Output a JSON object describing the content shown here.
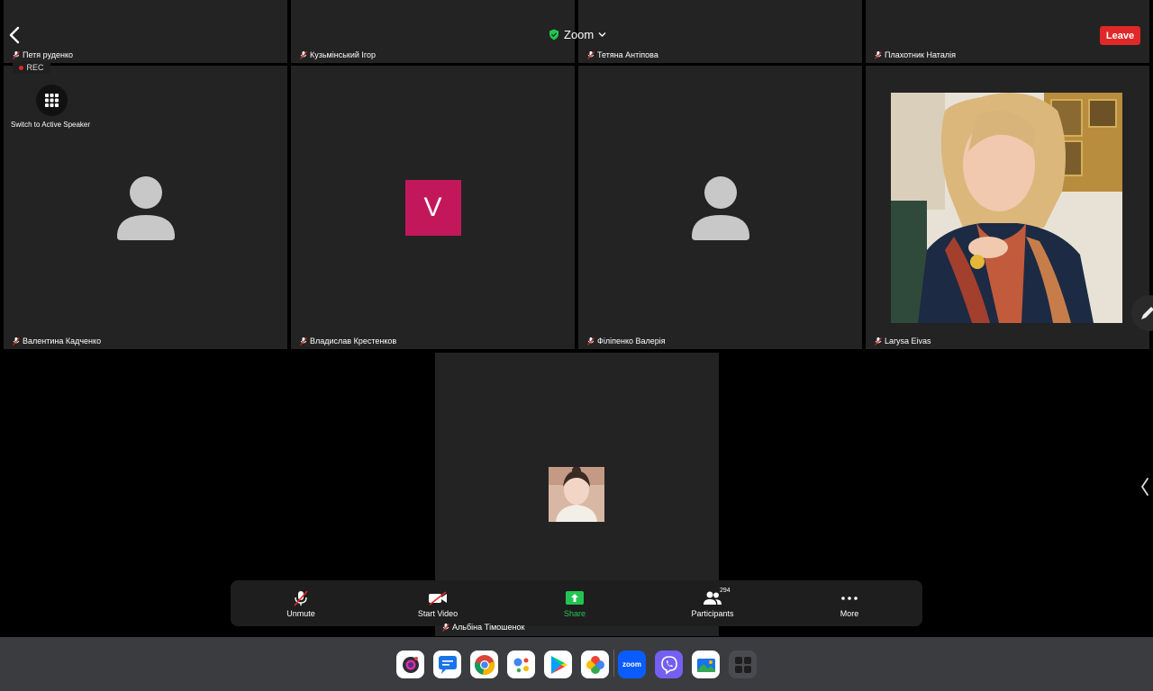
{
  "header": {
    "title": "Zoom",
    "leave_label": "Leave",
    "rec_label": "REC",
    "switch_label": "Switch to Active Speaker"
  },
  "participants_top": [
    {
      "name": "Петя руденко"
    },
    {
      "name": "Кузьмінський Ігор"
    },
    {
      "name": "Тетяна Антіпова"
    },
    {
      "name": "Плахотник Наталія"
    }
  ],
  "participants_main": [
    {
      "name": "Валентина Кадченко",
      "avatar": "person-icon"
    },
    {
      "name": "Владислав Крестенков",
      "avatar_letter": "V",
      "avatar_color": "#c2185b"
    },
    {
      "name": "Філіпенко Валерія",
      "avatar": "person-icon"
    },
    {
      "name": "Larysa Eivas",
      "avatar": "photo"
    }
  ],
  "active": {
    "name": "Альбіна Тімошенок"
  },
  "toolbar": {
    "unmute": "Unmute",
    "start_video": "Start Video",
    "share": "Share",
    "participants": "Participants",
    "participants_count": "294",
    "more": "More"
  },
  "colors": {
    "accent_green": "#23c552",
    "leave_red": "#e02828",
    "rec_red": "#e02828",
    "tile_bg": "#232323"
  },
  "dock_apps": [
    "camera-icon",
    "messages-icon",
    "chrome-icon",
    "assistant-icon",
    "play-store-icon",
    "photos-icon",
    "zoom-icon",
    "viber-icon",
    "gallery-icon",
    "app-drawer-icon"
  ],
  "dock": {
    "zoom_label": "zoom"
  }
}
